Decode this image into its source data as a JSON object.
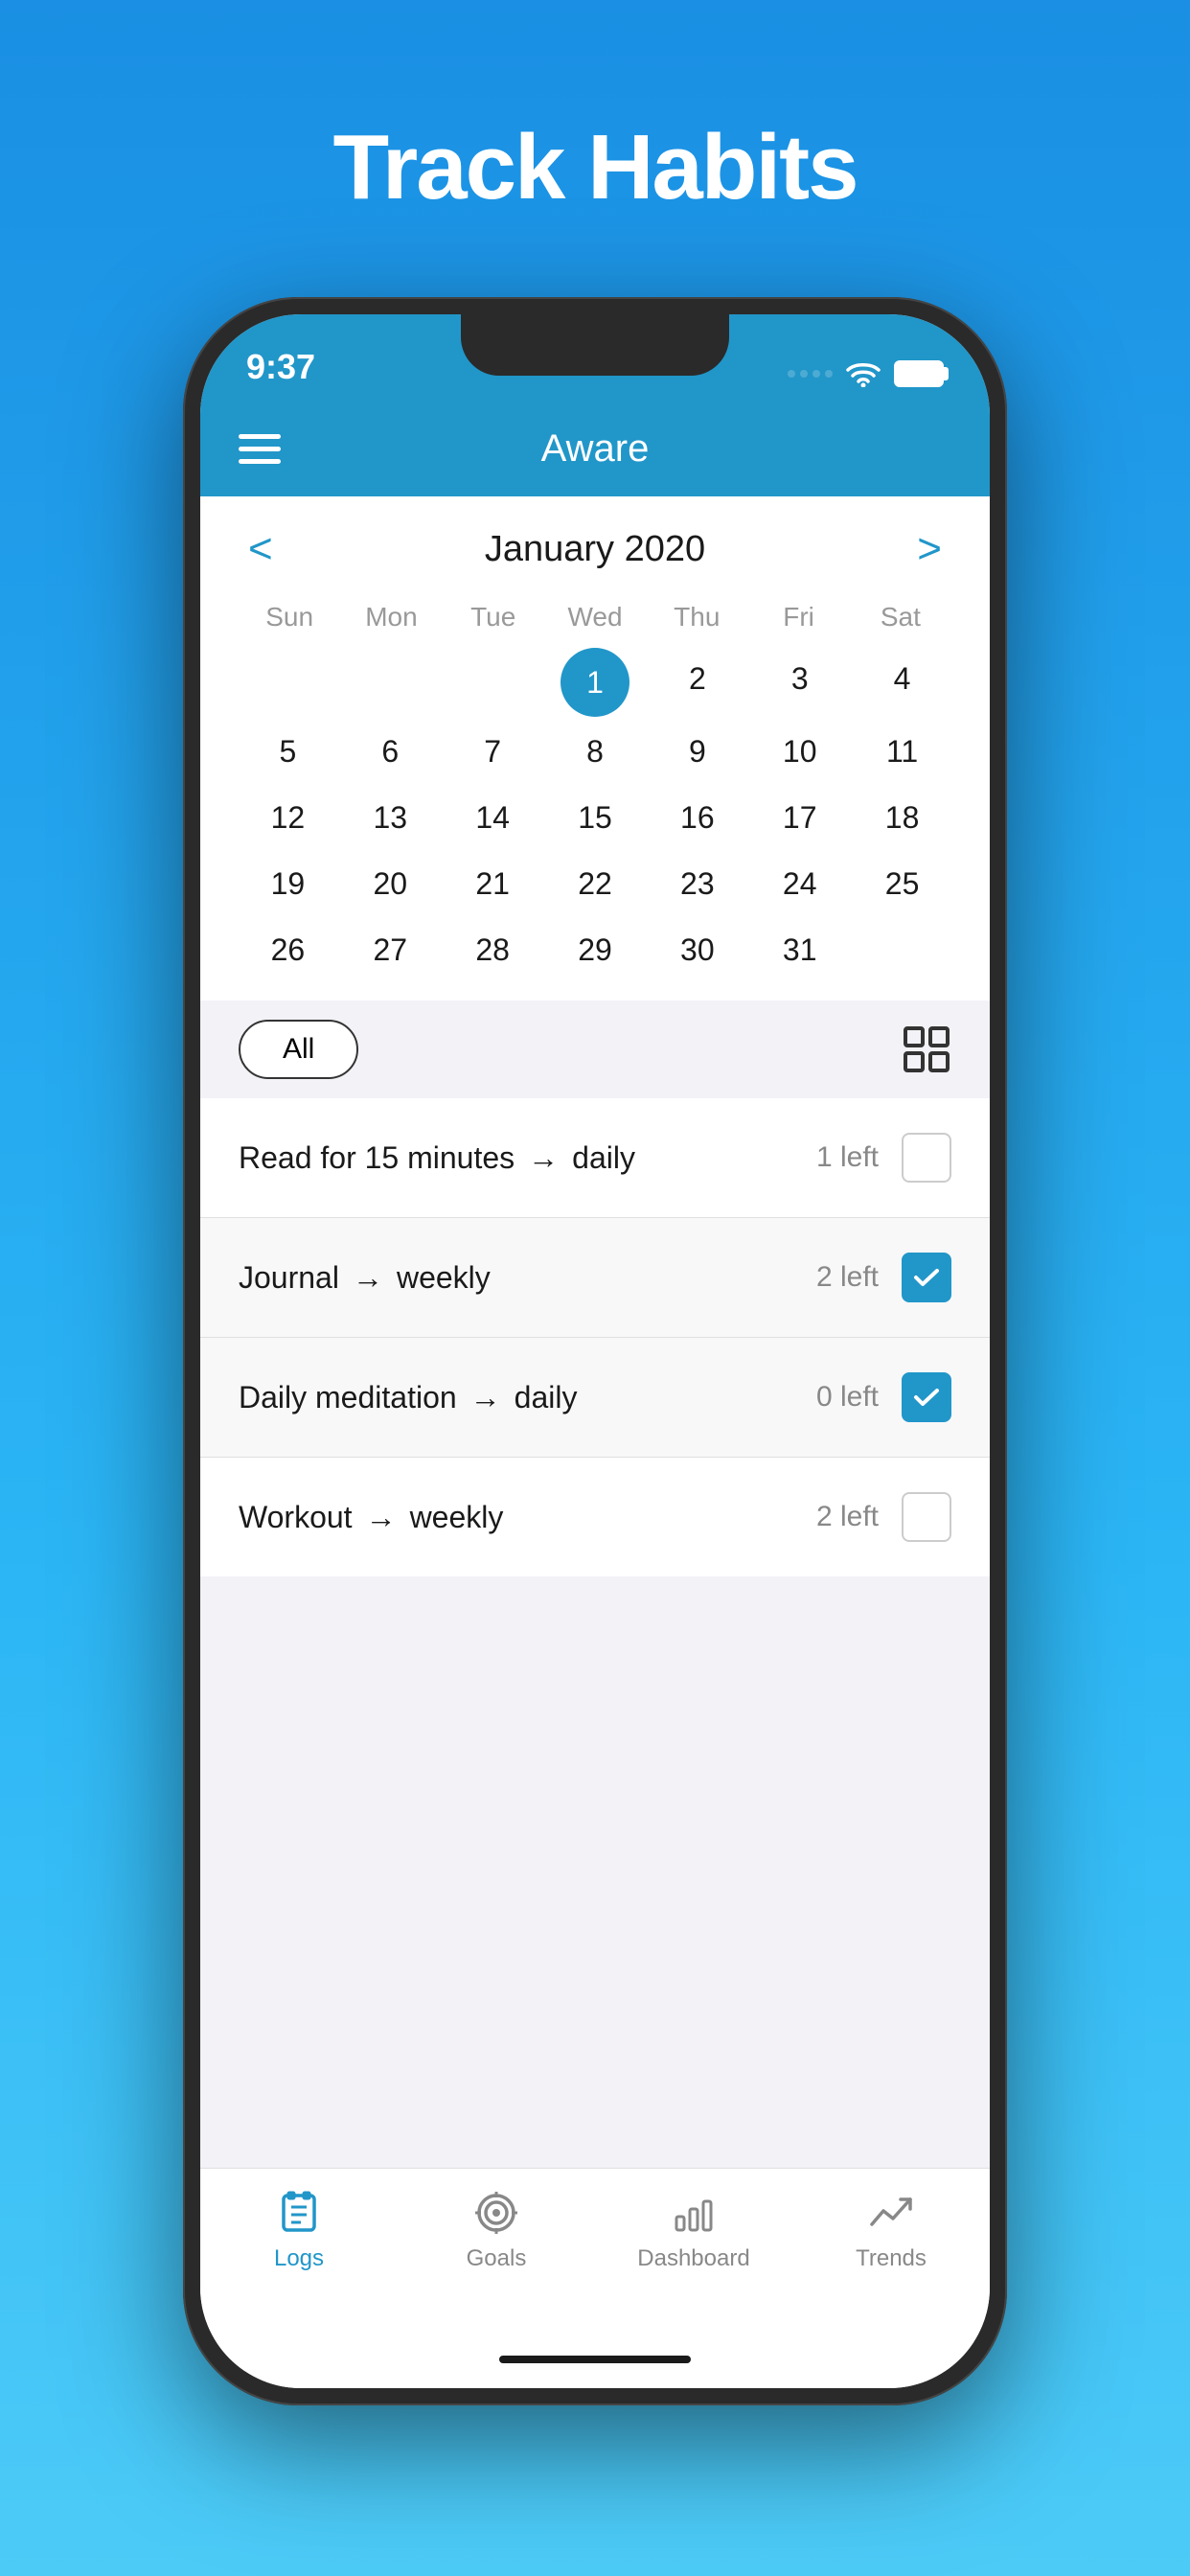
{
  "page": {
    "title": "Track Habits",
    "background_top": "#1a8fe3",
    "background_bottom": "#4dcbf7"
  },
  "status_bar": {
    "time": "9:37"
  },
  "header": {
    "app_name": "Aware",
    "menu_label": "menu"
  },
  "calendar": {
    "month_year": "January 2020",
    "prev_label": "<",
    "next_label": ">",
    "weekdays": [
      "Sun",
      "Mon",
      "Tue",
      "Wed",
      "Thu",
      "Fri",
      "Sat"
    ],
    "today_date": "1",
    "weeks": [
      [
        "",
        "",
        "",
        "1",
        "2",
        "3",
        "4"
      ],
      [
        "5",
        "6",
        "7",
        "8",
        "9",
        "10",
        "11"
      ],
      [
        "12",
        "13",
        "14",
        "15",
        "16",
        "17",
        "18"
      ],
      [
        "19",
        "20",
        "21",
        "22",
        "23",
        "24",
        "25"
      ],
      [
        "26",
        "27",
        "28",
        "29",
        "30",
        "31",
        ""
      ]
    ]
  },
  "filter": {
    "all_label": "All"
  },
  "habits": [
    {
      "id": "habit-read",
      "name": "Read for 15 minutes",
      "arrow": "→",
      "frequency": "daily",
      "count": "1 left",
      "checked": false
    },
    {
      "id": "habit-journal",
      "name": "Journal",
      "arrow": "→",
      "frequency": "weekly",
      "count": "2 left",
      "checked": true
    },
    {
      "id": "habit-meditation",
      "name": "Daily meditation",
      "arrow": "→",
      "frequency": "daily",
      "count": "0 left",
      "checked": true
    },
    {
      "id": "habit-workout",
      "name": "Workout",
      "arrow": "→",
      "frequency": "weekly",
      "count": "2 left",
      "checked": false
    }
  ],
  "tab_bar": {
    "tabs": [
      {
        "id": "logs",
        "label": "Logs",
        "active": true
      },
      {
        "id": "goals",
        "label": "Goals",
        "active": false
      },
      {
        "id": "dashboard",
        "label": "Dashboard",
        "active": false
      },
      {
        "id": "trends",
        "label": "Trends",
        "active": false
      }
    ]
  }
}
